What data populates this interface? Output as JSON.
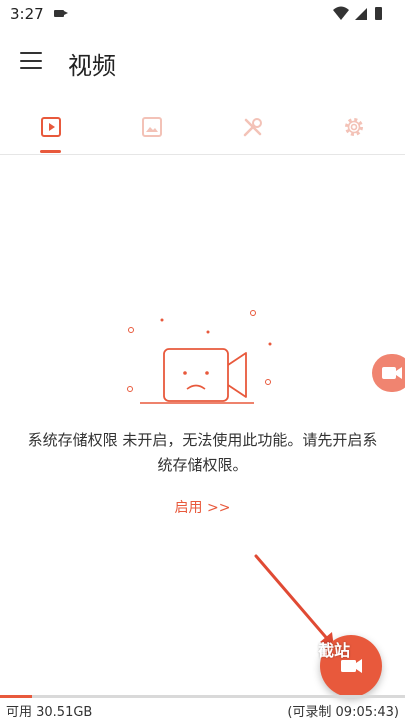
{
  "status_bar": {
    "time": "3:27"
  },
  "app_bar": {
    "title": "视频"
  },
  "tabs": [
    {
      "name": "video",
      "icon": "play-icon",
      "active": true
    },
    {
      "name": "image",
      "icon": "image-icon",
      "active": false
    },
    {
      "name": "tools",
      "icon": "tools-icon",
      "active": false
    },
    {
      "name": "settings",
      "icon": "gear-icon",
      "active": false
    }
  ],
  "empty_state": {
    "message": "系统存储权限 未开启，无法使用此功能。请先开启系统存储权限。",
    "message_line1": "系统存储权限 未开启，无法使用此功能。请先开启系",
    "message_line2": "统存储权限。",
    "enable_label": "启用 >>"
  },
  "fab": {
    "overlay_text": "截站"
  },
  "storage": {
    "available": "可用 30.51GB",
    "recordable": "(可录制 09:05:43)",
    "used_fraction": 0.08
  },
  "colors": {
    "accent": "#e8593c",
    "inactive_icon": "#f3c2b7"
  }
}
